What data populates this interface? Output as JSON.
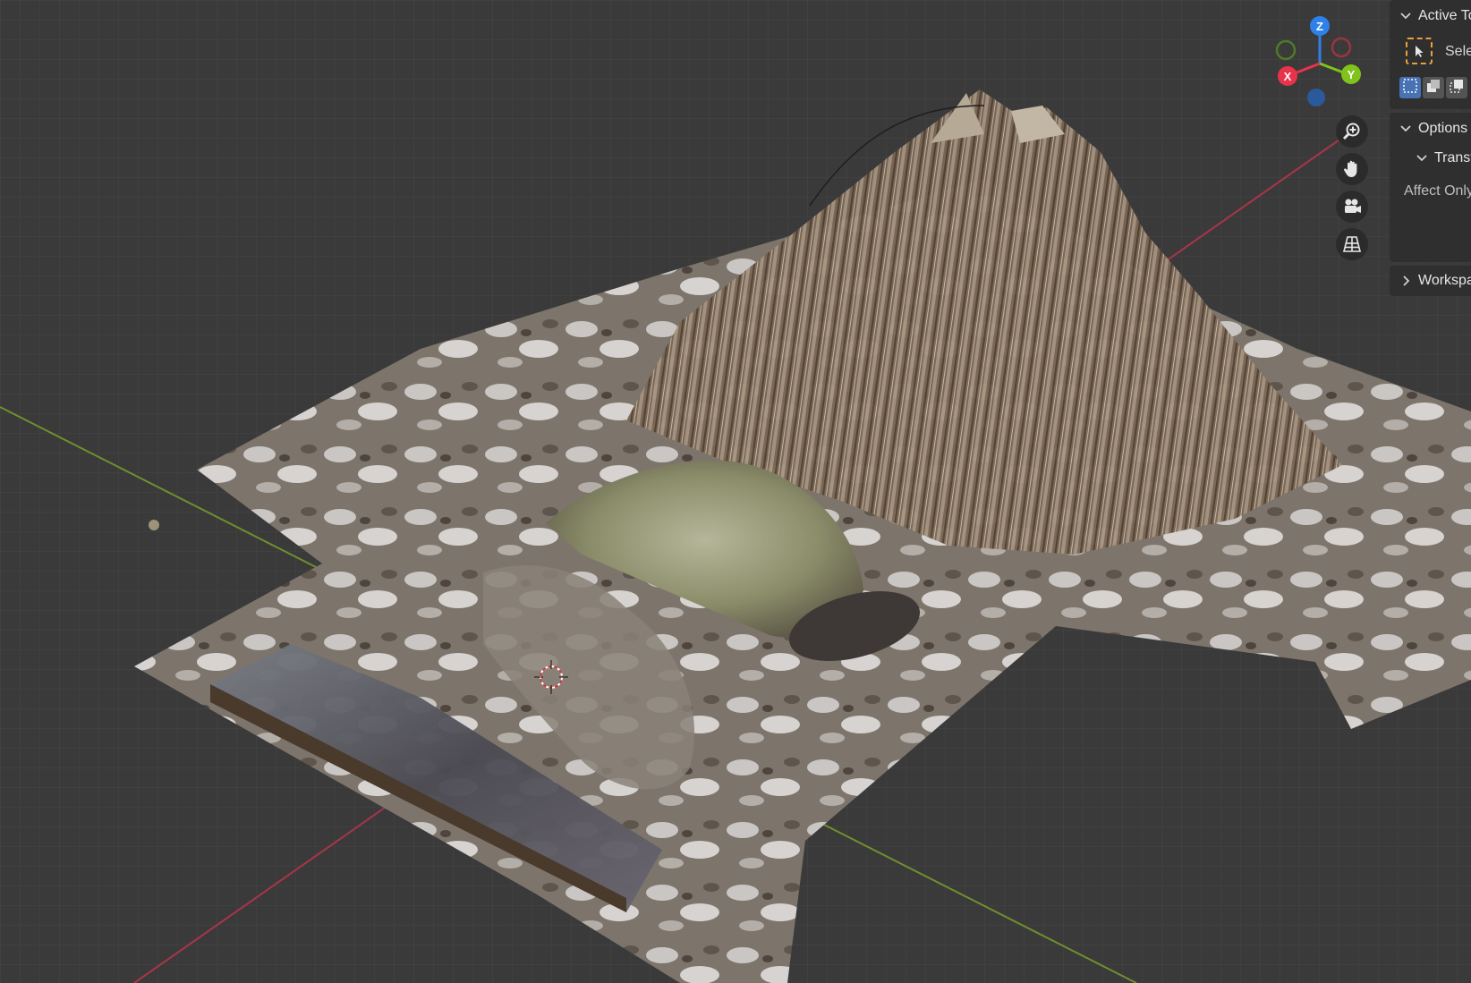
{
  "viewport": {
    "name": "3D Viewport",
    "scene_content": "terrain-with-mountain-pond-and-water-plane"
  },
  "gizmo": {
    "axes": {
      "x": "X",
      "y": "Y",
      "z": "Z"
    },
    "colors": {
      "x": "#e9334a",
      "y": "#80c31b",
      "z": "#2e81e8",
      "neg_x": "#9a3541",
      "neg_y": "#4f7a26",
      "neg_z": "#2a5a9b"
    }
  },
  "nav_buttons": [
    {
      "icon": "zoom-icon",
      "tooltip": "Zoom"
    },
    {
      "icon": "hand-pan-icon",
      "tooltip": "Move"
    },
    {
      "icon": "camera-view-icon",
      "tooltip": "Toggle the camera view"
    },
    {
      "icon": "perspective-grid-icon",
      "tooltip": "Switch the current view from perspective/orthographic projection"
    }
  ],
  "side_panel": {
    "active_tool": {
      "header": "Active Tool",
      "tool_label": "Select Box"
    },
    "options": {
      "header": "Options",
      "transform_header": "Transform",
      "affect_only_label": "Affect Only"
    },
    "workspace": {
      "header": "Workspace"
    },
    "select_modes": [
      "set",
      "extend",
      "subtract"
    ],
    "accent": "#4772b3",
    "tool_outline": "#e6a03c"
  }
}
